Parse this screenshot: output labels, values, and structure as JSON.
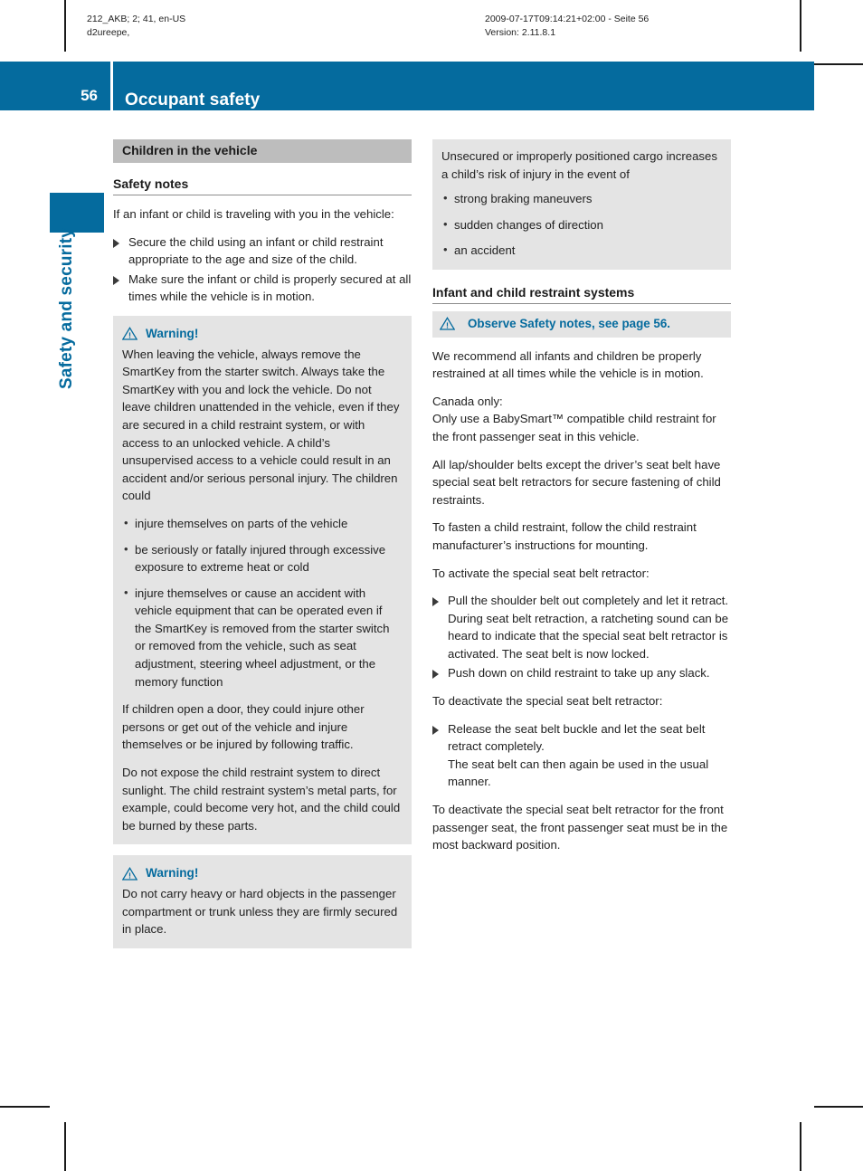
{
  "running_head": {
    "left": "212_AKB; 2; 41, en-US\nd2ureepe,",
    "right": "2009-07-17T09:14:21+02:00 - Seite 56\nVersion: 2.11.8.1"
  },
  "header": {
    "page_number": "56",
    "title": "Occupant safety",
    "accent_color": "#056b9e"
  },
  "chapter_tab": {
    "label": "Safety and security"
  },
  "left_column": {
    "section_heading": "Children in the vehicle",
    "sub_heading": "Safety notes",
    "intro": "If an infant or child is traveling with you in the vehicle:",
    "actions": [
      "Secure the child using an infant or child restraint appropriate to the age and size of the child.",
      "Make sure the infant or child is properly secured at all times while the vehicle is in motion."
    ],
    "warning_1": {
      "icon": "warning-triangle-icon",
      "title": "Warning!",
      "paragraph": "When leaving the vehicle, always remove the SmartKey from the starter switch. Always take the SmartKey with you and lock the vehicle. Do not leave children unattended in the vehicle, even if they are secured in a child restraint system, or with access to an unlocked vehicle. A child’s unsupervised access to a vehicle could result in an accident and/or serious personal injury. The children could",
      "bullets": [
        "injure themselves on parts of the vehicle",
        "be seriously or fatally injured through excessive exposure to extreme heat or cold",
        "injure themselves or cause an accident with vehicle equipment that can be operated even if the SmartKey is removed from the starter switch or removed from the vehicle, such as seat adjustment, steering wheel adjustment, or the memory function"
      ],
      "paragraph_2": "If children open a door, they could injure other persons or get out of the vehicle and injure themselves or be injured by following traffic.",
      "paragraph_3": "Do not expose the child restraint system to direct sunlight. The child restraint system’s metal parts, for example, could become very hot, and the child could be burned by these parts."
    },
    "warning_2": {
      "icon": "warning-triangle-icon",
      "title": "Warning!",
      "paragraph": "Do not carry heavy or hard objects in the passenger compartment or trunk unless they are firmly secured in place."
    }
  },
  "right_column": {
    "cargo_box": {
      "paragraph": "Unsecured or improperly positioned cargo increases a child’s risk of injury in the event of",
      "bullets": [
        "strong braking maneuvers",
        "sudden changes of direction",
        "an accident"
      ]
    },
    "sub_heading": "Infant and child restraint systems",
    "observe_note": {
      "icon": "warning-triangle-icon",
      "text": "Observe Safety notes, see page 56."
    },
    "paragraph_1": "We recommend all infants and children be properly restrained at all times while the vehicle is in motion.",
    "paragraph_2": "Canada only:\nOnly use a BabySmart™ compatible child restraint for the front passenger seat in this vehicle.",
    "paragraph_3": "All lap/shoulder belts except the driver’s seat belt have special seat belt retractors for secure fastening of child restraints.",
    "paragraph_4": "To fasten a child restraint, follow the child restraint manufacturer’s instructions for mounting.",
    "activate_intro": "To activate the special seat belt retractor:",
    "activate_step_1": "Pull the shoulder belt out completely and let it retract.",
    "activate_step_1_note": "During seat belt retraction, a ratcheting sound can be heard to indicate that the special seat belt retractor is activated. The seat belt is now locked.",
    "activate_step_2": "Push down on child restraint to take up any slack.",
    "deactivate_intro": "To deactivate the special seat belt retractor:",
    "deactivate_step_1": "Release the seat belt buckle and let the seat belt retract completely.",
    "deactivate_step_1_note": "The seat belt can then again be used in the usual manner.",
    "paragraph_5": "To deactivate the special seat belt retractor for the front passenger seat, the front passenger seat must be in the most backward position."
  }
}
